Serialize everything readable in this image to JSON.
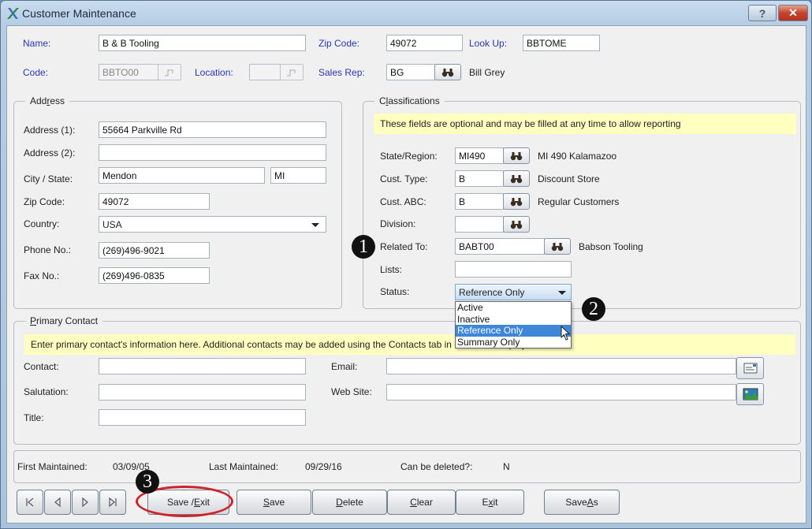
{
  "window": {
    "title": "Customer Maintenance",
    "help_label": "?",
    "close_label": "✕"
  },
  "header": {
    "name": {
      "label": "Name:",
      "value": "B & B Tooling"
    },
    "zip_code": {
      "label": "Zip Code:",
      "value": "49072"
    },
    "look_up": {
      "label": "Look Up:",
      "value": "BBTOME"
    },
    "code": {
      "label": "Code:",
      "value": "BBTO00"
    },
    "location": {
      "label": "Location:",
      "value": ""
    },
    "sales_rep": {
      "label": "Sales Rep:",
      "value": "BG",
      "description": "Bill Grey"
    }
  },
  "address": {
    "title": "Address",
    "address1": {
      "label": "Address (1):",
      "value": "55664 Parkville Rd"
    },
    "address2": {
      "label": "Address (2):",
      "value": ""
    },
    "city_state": {
      "label": "City / State:",
      "city": "Mendon",
      "state": "MI"
    },
    "zip_code": {
      "label": "Zip Code:",
      "value": "49072"
    },
    "country": {
      "label": "Country:",
      "value": "USA"
    },
    "phone": {
      "label": "Phone No.:",
      "value": "(269)496-9021"
    },
    "fax": {
      "label": "Fax No.:",
      "value": "(269)496-0835"
    }
  },
  "classifications": {
    "title": "Classifications",
    "note": "These fields are optional and may be filled at any time to allow reporting",
    "state_region": {
      "label": "State/Region:",
      "value": "MI490",
      "description": "MI 490 Kalamazoo"
    },
    "cust_type": {
      "label": "Cust. Type:",
      "value": "B",
      "description": "Discount Store"
    },
    "cust_abc": {
      "label": "Cust. ABC:",
      "value": "B",
      "description": "Regular Customers"
    },
    "division": {
      "label": "Division:",
      "value": ""
    },
    "related_to": {
      "label": "Related To:",
      "value": "BABT00",
      "description": "Babson Tooling"
    },
    "lists": {
      "label": "Lists:",
      "value": ""
    },
    "status": {
      "label": "Status:",
      "value": "Reference Only",
      "options": [
        "Active",
        "Inactive",
        "Reference Only",
        "Summary Only"
      ],
      "highlighted": "Reference Only"
    }
  },
  "primary_contact": {
    "title": "Primary Contact",
    "note": "Enter primary contact's information here. Additional contacts may be added using the Contacts tab in Customer Inquiry.",
    "contact": {
      "label": "Contact:",
      "value": ""
    },
    "salutation": {
      "label": "Salutation:",
      "value": ""
    },
    "title_field": {
      "label": "Title:",
      "value": ""
    },
    "email": {
      "label": "Email:",
      "value": ""
    },
    "web_site": {
      "label": "Web Site:",
      "value": ""
    }
  },
  "footer": {
    "first_maintained": {
      "label": "First Maintained:",
      "value": "03/09/05"
    },
    "last_maintained": {
      "label": "Last Maintained:",
      "value": "09/29/16"
    },
    "can_be_deleted": {
      "label": "Can be deleted?:",
      "value": "N"
    }
  },
  "buttons": {
    "save_exit": {
      "pre": "Save / ",
      "u": "E",
      "post": "xit"
    },
    "save": {
      "pre": "",
      "u": "S",
      "post": "ave"
    },
    "delete": {
      "pre": "",
      "u": "D",
      "post": "elete"
    },
    "clear": {
      "pre": "",
      "u": "C",
      "post": "lear"
    },
    "exit": {
      "pre": "E",
      "u": "x",
      "post": "it"
    },
    "save_as": {
      "pre": "Save ",
      "u": "A",
      "post": "s"
    }
  },
  "annotations": {
    "badge1": "1",
    "badge2": "2",
    "badge3": "3"
  },
  "colors": {
    "label_blue": "#2a35b0",
    "note_yellow": "#ffffc0",
    "highlight_red": "#d0222a",
    "selection_blue": "#3d86d8"
  }
}
